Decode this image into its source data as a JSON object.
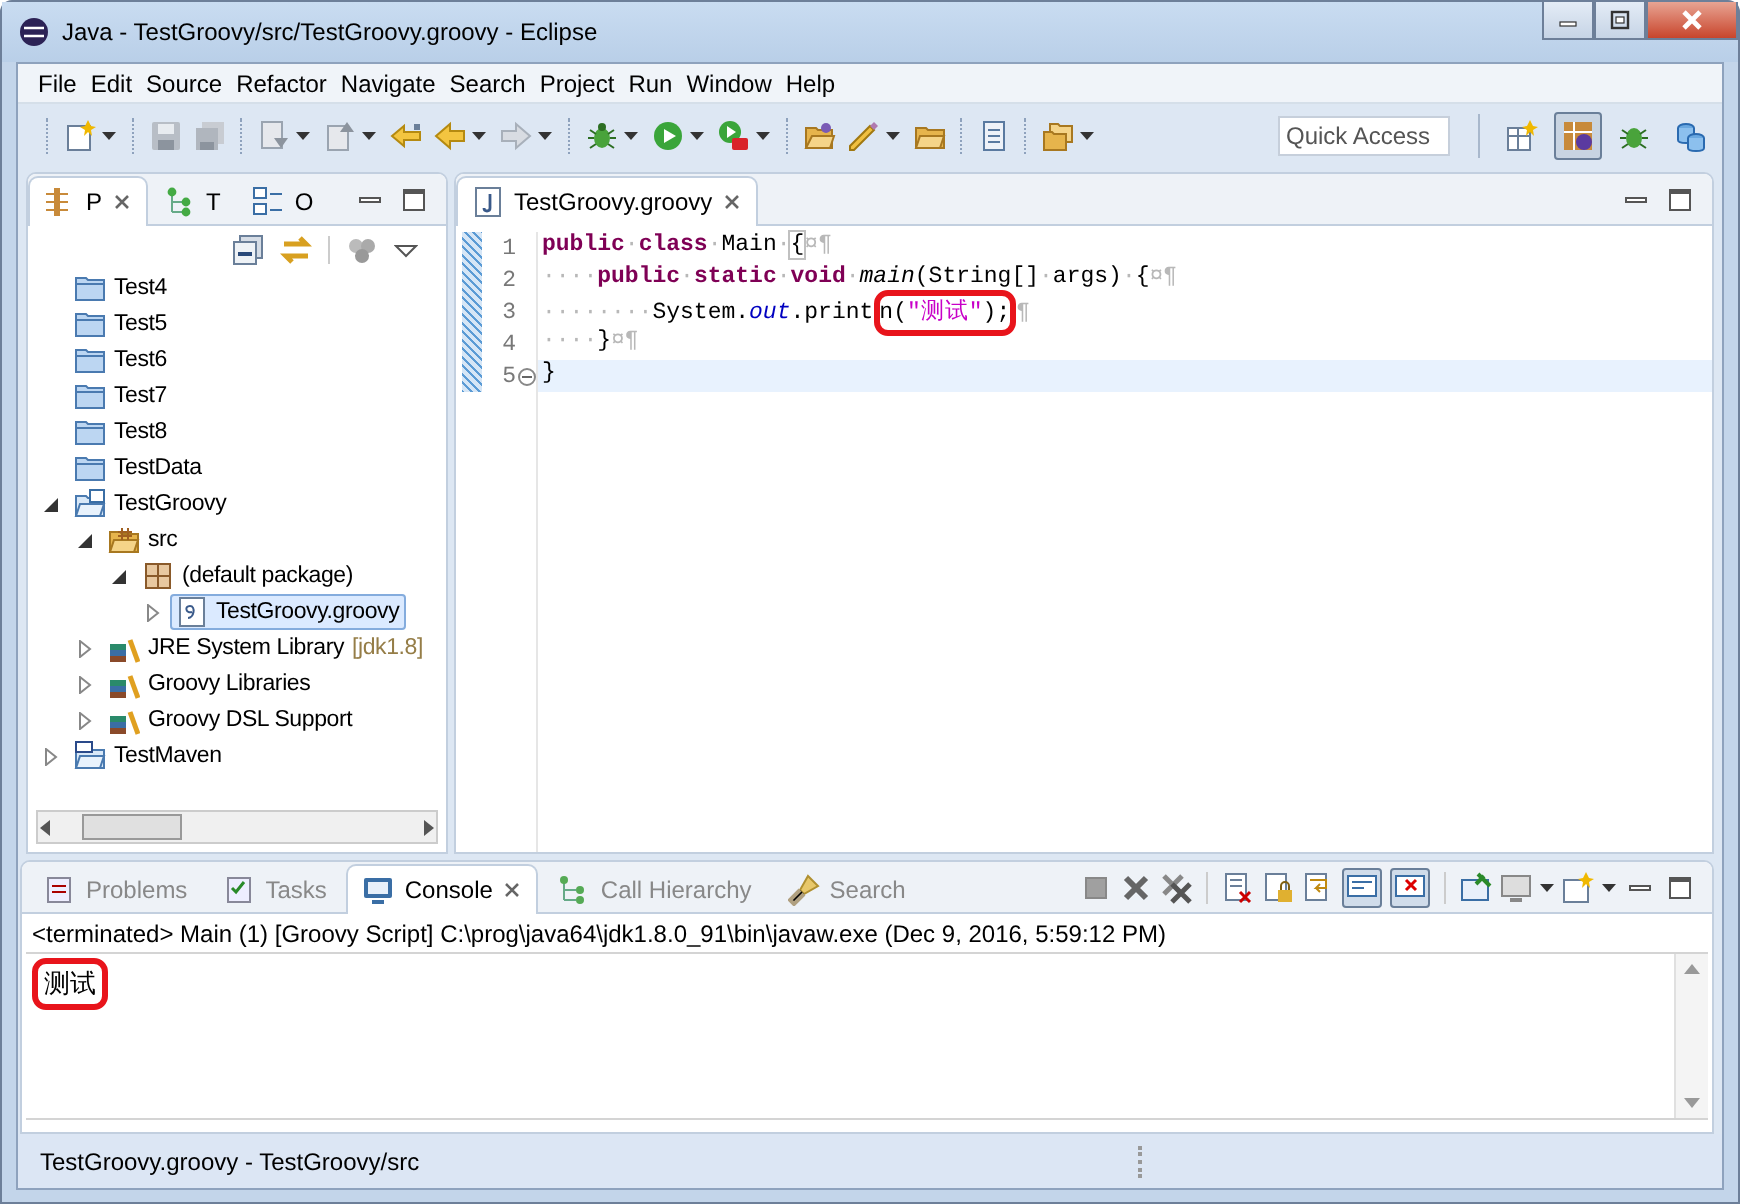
{
  "window": {
    "title": "Java - TestGroovy/src/TestGroovy.groovy - Eclipse"
  },
  "menu": [
    "File",
    "Edit",
    "Source",
    "Refactor",
    "Navigate",
    "Search",
    "Project",
    "Run",
    "Window",
    "Help"
  ],
  "toolbar": {
    "quick_access": {
      "placeholder": "Quick Access"
    }
  },
  "explorer": {
    "tabs": [
      {
        "label": "P",
        "selected": true
      },
      {
        "label": "T",
        "selected": false
      },
      {
        "label": "O",
        "selected": false
      }
    ],
    "tree": [
      {
        "kind": "folder",
        "label": "Test4",
        "selected": false
      },
      {
        "kind": "folder",
        "label": "Test5",
        "selected": false
      },
      {
        "kind": "folder",
        "label": "Test6",
        "selected": false
      },
      {
        "kind": "folder",
        "label": "Test7",
        "selected": false
      },
      {
        "kind": "folder",
        "label": "Test8",
        "selected": false
      },
      {
        "kind": "folder",
        "label": "TestData",
        "selected": false
      },
      {
        "kind": "project",
        "label": "TestGroovy",
        "selected": false,
        "expanded": true,
        "children": [
          {
            "kind": "source",
            "label": "src",
            "selected": false,
            "expanded": true,
            "children": [
              {
                "kind": "package",
                "label": "(default package)",
                "selected": false,
                "expanded": true,
                "children": [
                  {
                    "kind": "file",
                    "label": "TestGroovy.groovy",
                    "selected": true,
                    "expanded": false
                  }
                ]
              }
            ]
          },
          {
            "kind": "library",
            "label": "JRE System Library",
            "decoration": "[jdk1.8]",
            "selected": false,
            "expanded": false
          },
          {
            "kind": "library",
            "label": "Groovy Libraries",
            "selected": false,
            "expanded": false
          },
          {
            "kind": "library",
            "label": "Groovy DSL Support",
            "selected": false,
            "expanded": false
          }
        ]
      },
      {
        "kind": "maven",
        "label": "TestMaven",
        "selected": false,
        "expanded": false
      }
    ]
  },
  "editor": {
    "tab": {
      "label": "TestGroovy.groovy",
      "selected": true
    },
    "lines": [
      {
        "number": "1",
        "current": false,
        "tokens": [
          {
            "kind": "keyword",
            "text": "public"
          },
          {
            "kind": "whitespace",
            "text": "·"
          },
          {
            "kind": "keyword",
            "text": "class"
          },
          {
            "kind": "whitespace",
            "text": "·"
          },
          {
            "kind": "text",
            "text": "Main"
          },
          {
            "kind": "whitespace",
            "text": "·"
          },
          {
            "kind": "bracket",
            "text": "{"
          },
          {
            "kind": "whitespace",
            "text": "¤¶"
          }
        ]
      },
      {
        "number": "2",
        "current": false,
        "tokens": [
          {
            "kind": "whitespace",
            "text": "····"
          },
          {
            "kind": "keyword",
            "text": "public"
          },
          {
            "kind": "whitespace",
            "text": "·"
          },
          {
            "kind": "keyword",
            "text": "static"
          },
          {
            "kind": "whitespace",
            "text": "·"
          },
          {
            "kind": "keyword",
            "text": "void"
          },
          {
            "kind": "whitespace",
            "text": "·"
          },
          {
            "kind": "method",
            "text": "main"
          },
          {
            "kind": "text",
            "text": "(String[]"
          },
          {
            "kind": "whitespace",
            "text": "·"
          },
          {
            "kind": "text",
            "text": "args)"
          },
          {
            "kind": "whitespace",
            "text": "·"
          },
          {
            "kind": "text",
            "text": "{"
          },
          {
            "kind": "whitespace",
            "text": "¤¶"
          }
        ]
      },
      {
        "number": "3",
        "current": false,
        "tokens": [
          {
            "kind": "whitespace",
            "text": "········"
          },
          {
            "kind": "text",
            "text": "System."
          },
          {
            "kind": "field",
            "text": "out"
          },
          {
            "kind": "text",
            "text": ".print"
          },
          {
            "kind": "text",
            "text": "n(",
            "circled": true
          },
          {
            "kind": "string",
            "text": "\"测试\"",
            "circled": true
          },
          {
            "kind": "text",
            "text": ");",
            "circled": true
          },
          {
            "kind": "whitespace",
            "text": "¶"
          }
        ]
      },
      {
        "number": "4",
        "current": false,
        "tokens": [
          {
            "kind": "whitespace",
            "text": "····"
          },
          {
            "kind": "text",
            "text": "}"
          },
          {
            "kind": "whitespace",
            "text": "¤¶"
          }
        ]
      },
      {
        "number": "5",
        "current": true,
        "folded": false,
        "tokens": [
          {
            "kind": "text",
            "text": "}"
          }
        ]
      }
    ]
  },
  "console": {
    "tabs": [
      {
        "label": "Problems",
        "selected": false
      },
      {
        "label": "Tasks",
        "selected": false
      },
      {
        "label": "Console",
        "selected": true
      },
      {
        "label": "Call Hierarchy",
        "selected": false
      },
      {
        "label": "Search",
        "selected": false
      }
    ],
    "header": "<terminated> Main (1) [Groovy Script] C:\\prog\\java64\\jdk1.8.0_91\\bin\\javaw.exe (Dec 9, 2016, 5:59:12 PM)",
    "output": [
      {
        "text": "测试",
        "circled": true
      }
    ]
  },
  "status_bar": {
    "text": "TestGroovy.groovy - TestGroovy/src"
  }
}
